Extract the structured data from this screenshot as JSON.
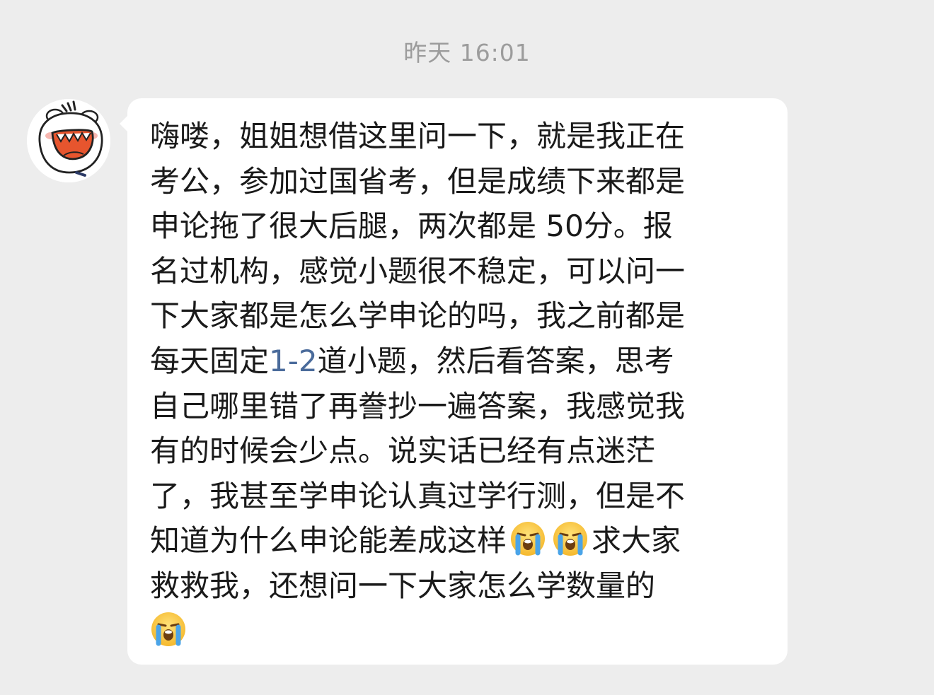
{
  "chat": {
    "timestamp": "昨天 16:01"
  },
  "message": {
    "sender_avatar": "cartoon-bear-avatar",
    "lines": {
      "l1": "嗨喽，姐姐想借这里问一下，就是我正在",
      "l2": "考公，参加过国省考，但是成绩下来都是",
      "l3": "申论拖了很大后腿，两次都是 50分。报",
      "l4": "名过机构，感觉小题很不稳定，可以问一",
      "l5": "下大家都是怎么学申论的吗，我之前都是",
      "l6_a": "每天固定",
      "l6_link": "1-2",
      "l6_b": "道小题，然后看答案，思考",
      "l7": "自己哪里错了再誊抄一遍答案，我感觉我",
      "l8": "有的时候会少点。说实话已经有点迷茫",
      "l9": "了，我甚至学申论认真过学行测，但是不",
      "l10_a": "知道为什么申论能差成这样",
      "l10_b": "求大家",
      "l11": "救救我，还想问一下大家怎么学数量的"
    },
    "emoji_name": "loudly-crying-face",
    "link_color": "#4a6b9b"
  }
}
